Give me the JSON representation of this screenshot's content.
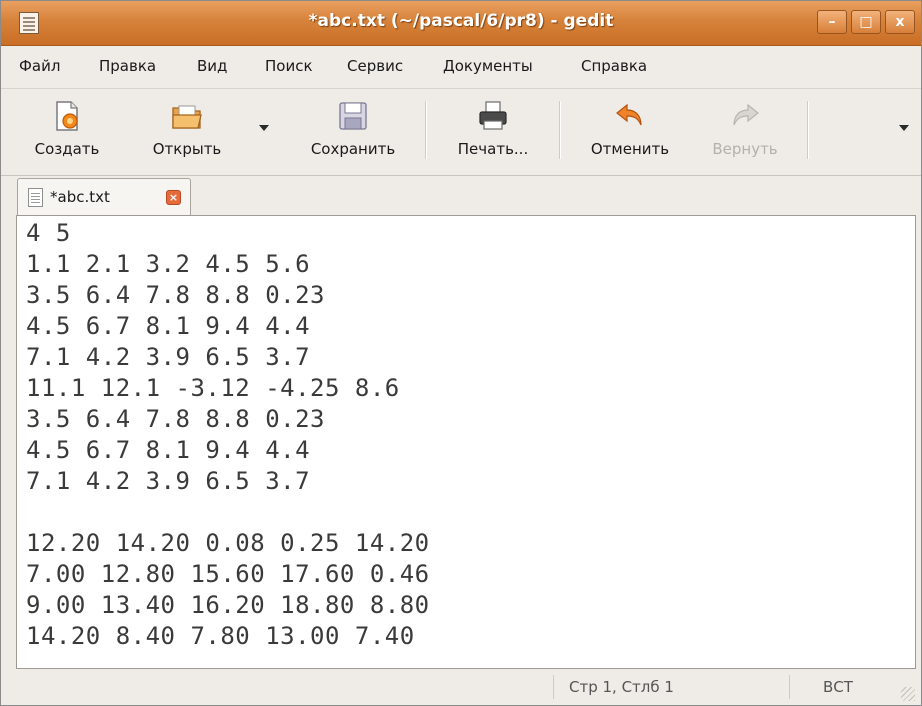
{
  "window": {
    "title": "*abc.txt (~/pascal/6/pr8) - gedit",
    "controls": {
      "minimize": "–",
      "maximize": "□",
      "close": "x"
    }
  },
  "menu": {
    "items": [
      "Файл",
      "Правка",
      "Вид",
      "Поиск",
      "Сервис",
      "Документы",
      "Справка"
    ]
  },
  "toolbar": {
    "new_label": "Создать",
    "open_label": "Открыть",
    "save_label": "Сохранить",
    "print_label": "Печать...",
    "undo_label": "Отменить",
    "redo_label": "Вернуть",
    "icons": {
      "new": "new-document-icon",
      "open": "open-folder-icon",
      "save": "floppy-disk-icon",
      "print": "printer-icon",
      "undo": "undo-arrow-icon",
      "redo": "redo-arrow-icon"
    }
  },
  "tab": {
    "label": "*abc.txt",
    "close": "×"
  },
  "editor": {
    "lines": [
      "4 5",
      "1.1 2.1 3.2 4.5 5.6",
      "3.5 6.4 7.8 8.8 0.23",
      "4.5 6.7 8.1 9.4 4.4",
      "7.1 4.2 3.9 6.5 3.7",
      "11.1 12.1 -3.12 -4.25 8.6",
      "3.5 6.4 7.8 8.8 0.23",
      "4.5 6.7 8.1 9.4 4.4",
      "7.1 4.2 3.9 6.5 3.7",
      "",
      "12.20 14.20 0.08 0.25 14.20",
      "7.00 12.80 15.60 17.60 0.46",
      "9.00 13.40 16.20 18.80 8.80",
      "14.20 8.40 7.80 13.00 7.40"
    ]
  },
  "status": {
    "position": "Стр 1, Стлб 1",
    "mode": "ВСТ"
  },
  "colors": {
    "titlebar": "#d6823a",
    "window_bg": "#efebe7",
    "editor_bg": "#ffffff",
    "editor_text": "#3a3a3a"
  }
}
